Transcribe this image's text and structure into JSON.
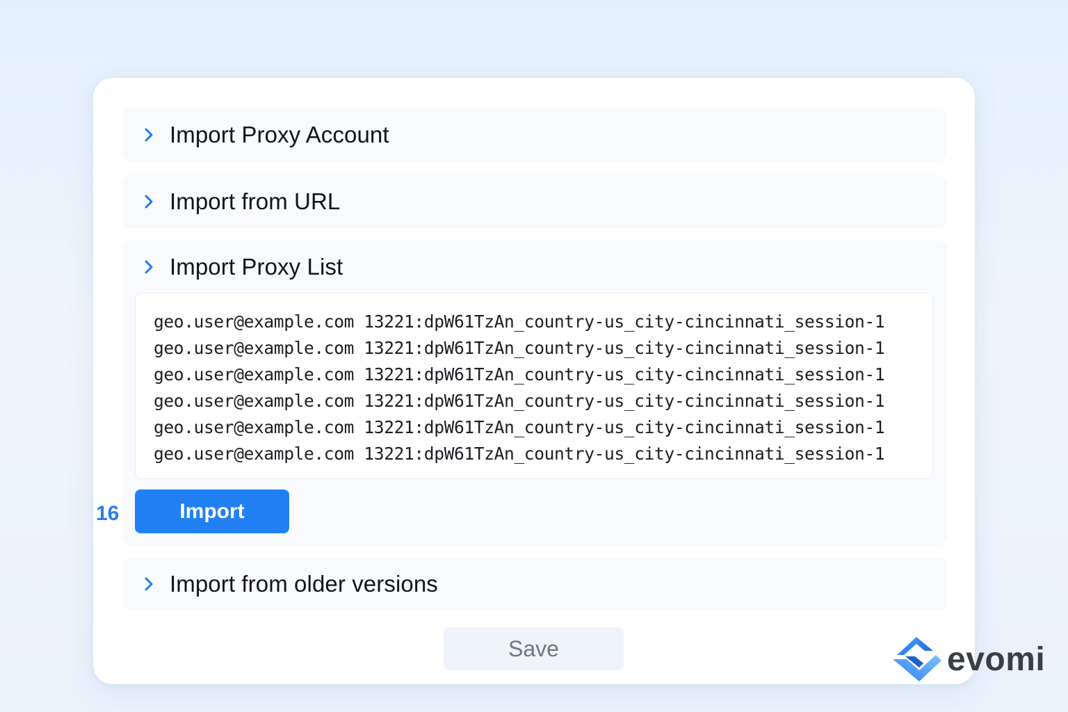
{
  "sections": {
    "account": {
      "title": "Import Proxy Account",
      "expanded": false
    },
    "url": {
      "title": "Import from URL",
      "expanded": false
    },
    "list": {
      "title": "Import Proxy List",
      "expanded": true,
      "lines": [
        "geo.user@example.com 13221:dpW61TzAn_country-us_city-cincinnati_session-1",
        "geo.user@example.com 13221:dpW61TzAn_country-us_city-cincinnati_session-1",
        "geo.user@example.com 13221:dpW61TzAn_country-us_city-cincinnati_session-1",
        "geo.user@example.com 13221:dpW61TzAn_country-us_city-cincinnati_session-1",
        "geo.user@example.com 13221:dpW61TzAn_country-us_city-cincinnati_session-1",
        "geo.user@example.com 13221:dpW61TzAn_country-us_city-cincinnati_session-1"
      ],
      "count_label": "16",
      "import_label": "Import"
    },
    "older": {
      "title": "Import from older versions",
      "expanded": false
    }
  },
  "save_label": "Save",
  "brand": {
    "name": "evomi"
  },
  "icons": {
    "chevron": "chevron-right-icon",
    "logo": "evomi-logo-icon"
  },
  "colors": {
    "accent": "#2280f5",
    "chevron": "#1f7ae8",
    "save_bg": "#eff4fb",
    "save_text": "#6f7680"
  }
}
